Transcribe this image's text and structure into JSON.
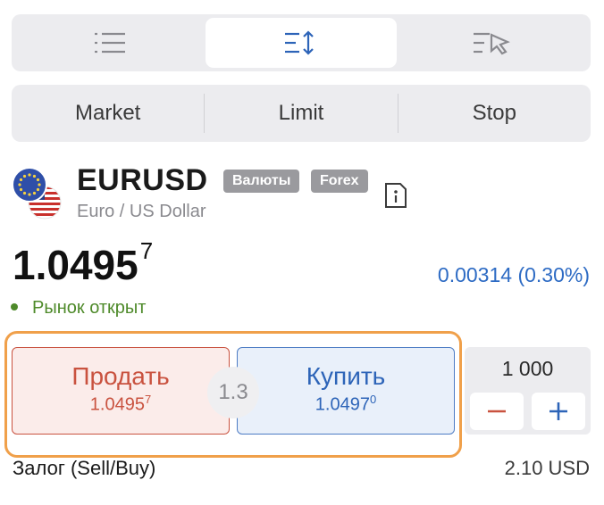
{
  "view_tabs": [
    {
      "icon": "list-icon",
      "active": false
    },
    {
      "icon": "sort-order-icon",
      "active": true
    },
    {
      "icon": "list-cursor-icon",
      "active": false
    }
  ],
  "order_types": [
    "Market",
    "Limit",
    "Stop"
  ],
  "instrument": {
    "symbol": "EURUSD",
    "badges": [
      "Валюты",
      "Forex"
    ],
    "description": "Euro / US Dollar",
    "flags_icon": "eu-us-flags-icon",
    "info_icon": "info-icon"
  },
  "price": {
    "main": "1.0495",
    "pip": "7"
  },
  "change": "0.00314 (0.30%)",
  "market_status": "Рынок открыт",
  "sell": {
    "label": "Продать",
    "price_main": "1.0495",
    "price_pip": "7"
  },
  "buy": {
    "label": "Купить",
    "price_main": "1.0497",
    "price_pip": "0"
  },
  "spread": "1.3",
  "quantity": {
    "value": "1 000",
    "minus": "−",
    "plus": "+"
  },
  "margin": {
    "label": "Залог (Sell/Buy)",
    "value": "2.10 USD"
  },
  "colors": {
    "sell": "#c9523f",
    "buy": "#2d64b8",
    "accent": "#2d6bc4",
    "highlight": "#f0a04a",
    "status": "#4e8a2a"
  }
}
